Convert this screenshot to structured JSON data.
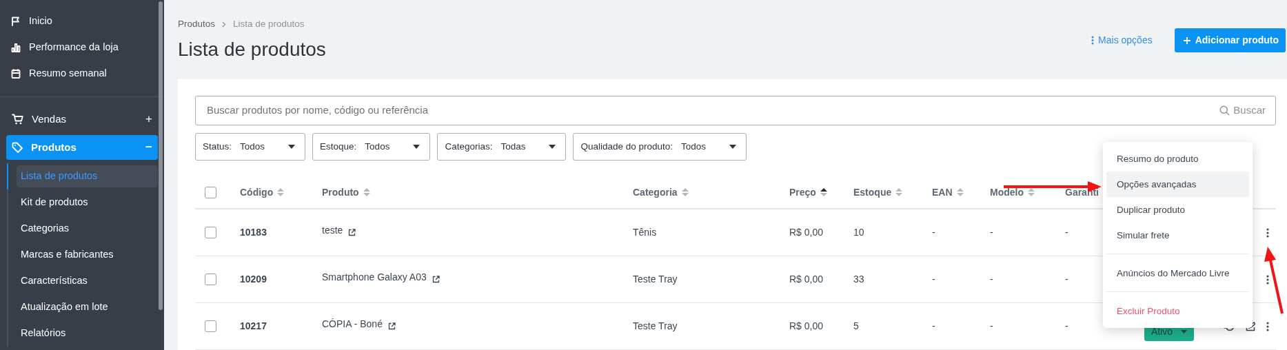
{
  "sidebar": {
    "items": [
      {
        "label": "Inicio"
      },
      {
        "label": "Performance da loja"
      },
      {
        "label": "Resumo semanal"
      }
    ],
    "sections": [
      {
        "label": "Vendas",
        "toggle": "+",
        "selected": false
      },
      {
        "label": "Produtos",
        "toggle": "−",
        "selected": true,
        "children": [
          {
            "label": "Lista de produtos",
            "selected": true
          },
          {
            "label": "Kit de produtos",
            "selected": false
          },
          {
            "label": "Categorias",
            "selected": false
          },
          {
            "label": "Marcas e fabricantes",
            "selected": false
          },
          {
            "label": "Características",
            "selected": false
          },
          {
            "label": "Atualização em lote",
            "selected": false
          },
          {
            "label": "Relatórios",
            "selected": false
          }
        ]
      }
    ]
  },
  "breadcrumb": [
    "Produtos",
    "Lista de produtos"
  ],
  "title": "Lista de produtos",
  "more_options": "Mais opções",
  "add_button": "Adicionar produto",
  "search": {
    "placeholder": "Buscar produtos por nome, código ou referência",
    "button": "Buscar"
  },
  "filters": [
    {
      "label": "Status:",
      "value": "Todos"
    },
    {
      "label": "Estoque:",
      "value": "Todos"
    },
    {
      "label": "Categorias:",
      "value": "Todas"
    },
    {
      "label": "Qualidade do produto:",
      "value": "Todos"
    }
  ],
  "table": {
    "select_all_checked": false,
    "columns": [
      {
        "label": "Código",
        "sorted": false
      },
      {
        "label": "Produto",
        "sorted": false
      },
      {
        "label": "Categoria",
        "sorted": false
      },
      {
        "label": "Preço",
        "sorted": true
      },
      {
        "label": "Estoque",
        "sorted": false
      },
      {
        "label": "EAN",
        "sorted": false
      },
      {
        "label": "Modelo",
        "sorted": false
      },
      {
        "label": "Garanti"
      }
    ],
    "rows": [
      {
        "checked": false,
        "code": "10183",
        "product": "teste",
        "category": "Tênis",
        "price": "R$ 0,00",
        "stock": "10",
        "ean": "-",
        "model": "-",
        "warranty": "-"
      },
      {
        "checked": false,
        "code": "10209",
        "product": "Smartphone Galaxy A03",
        "category": "Teste Tray",
        "price": "R$ 0,00",
        "stock": "33",
        "ean": "-",
        "model": "-",
        "warranty": "-"
      },
      {
        "checked": false,
        "code": "10217",
        "product": "CÓPIA - Boné",
        "category": "Teste Tray",
        "price": "R$ 0,00",
        "stock": "5",
        "ean": "-",
        "model": "-",
        "warranty": "-",
        "status": "Ativo"
      }
    ]
  },
  "row_menu": {
    "items": [
      {
        "kind": "item",
        "label": "Resumo do produto",
        "selected": false
      },
      {
        "kind": "item",
        "label": "Opções avançadas",
        "selected": true
      },
      {
        "kind": "item",
        "label": "Duplicar produto",
        "selected": false
      },
      {
        "kind": "item",
        "label": "Simular frete",
        "selected": false
      },
      {
        "kind": "divider"
      },
      {
        "kind": "item",
        "label": "Anúncios do Mercado Livre",
        "selected": false
      },
      {
        "kind": "divider"
      },
      {
        "kind": "danger",
        "label": "Excluir Produto",
        "selected": false
      }
    ]
  },
  "annotations": [
    {
      "kind": "arrow"
    },
    {
      "kind": "arrow"
    }
  ]
}
